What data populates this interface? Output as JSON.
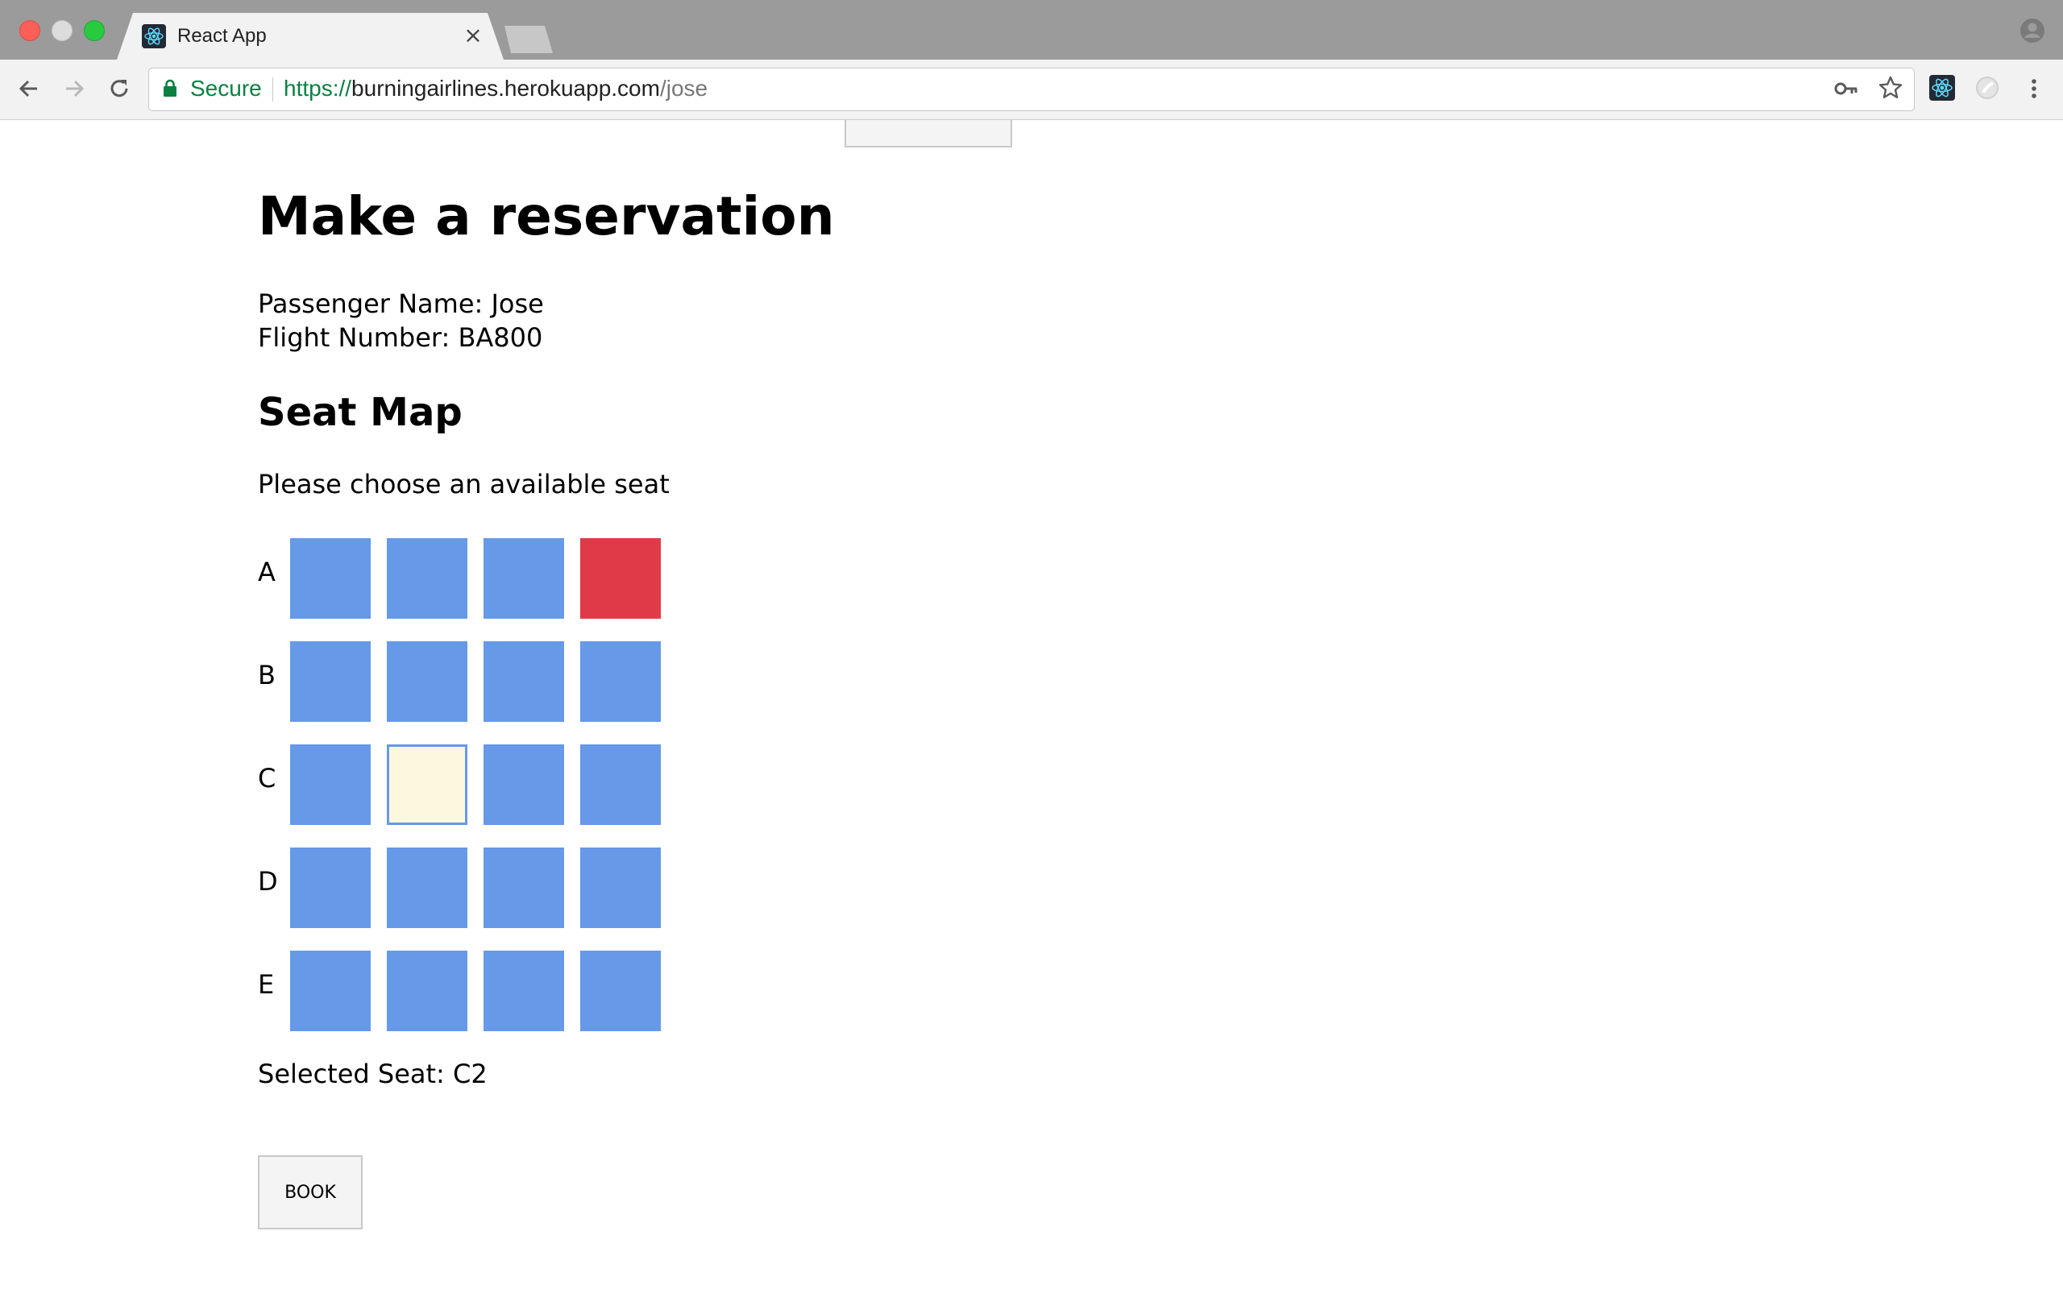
{
  "browser": {
    "tab_title": "React App",
    "tab_close": "×",
    "secure_label": "Secure",
    "url_scheme": "https://",
    "url_host": "burningairlines.herokuapp.com",
    "url_path": "/jose"
  },
  "page": {
    "heading": "Make a reservation",
    "passenger_line": "Passenger Name: Jose",
    "flight_line": "Flight Number: BA800",
    "seat_map_heading": "Seat Map",
    "instruction": "Please choose an available seat",
    "selected_seat_line": "Selected Seat: C2",
    "book_label": "BOOK"
  },
  "seat_map": {
    "rows": [
      "A",
      "B",
      "C",
      "D",
      "E"
    ],
    "seats_per_row": 4,
    "taken": [
      "A4"
    ],
    "selected": "C2",
    "colors": {
      "available": "#6699e8",
      "taken": "#e03a48",
      "selected": "#fdf7dd"
    }
  }
}
